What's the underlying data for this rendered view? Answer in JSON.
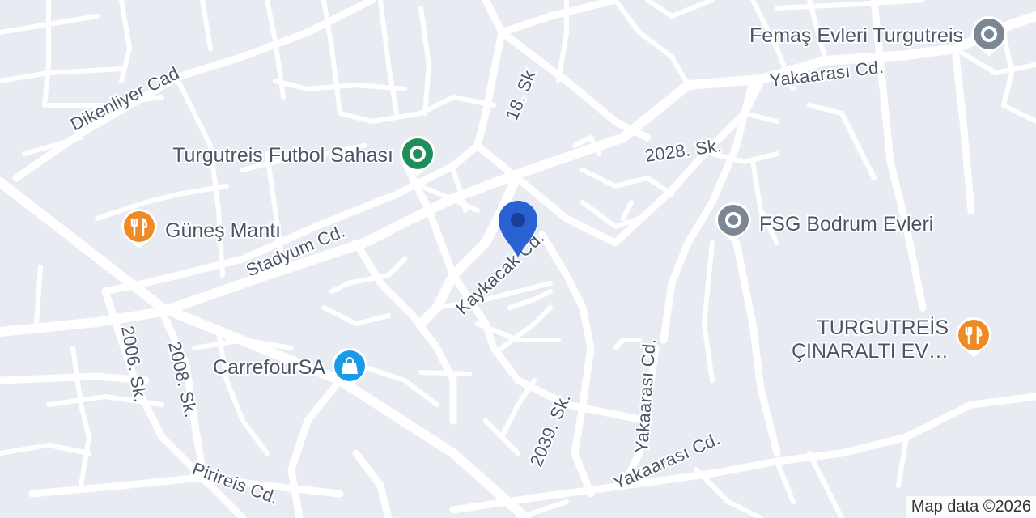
{
  "map": {
    "attribution": "Map data ©2026",
    "roads": [
      {
        "label": "Dikenliyer Cad",
        "name": "road-label-dikenliyer"
      },
      {
        "label": "18. Sk",
        "name": "road-label-18-sk"
      },
      {
        "label": "Yakaarası Cd.",
        "name": "road-label-yakaarasi-top"
      },
      {
        "label": "2028. Sk.",
        "name": "road-label-2028-sk"
      },
      {
        "label": "Stadyum Cd.",
        "name": "road-label-stadyum"
      },
      {
        "label": "Kaykacak Cd.",
        "name": "road-label-kaykacak"
      },
      {
        "label": "2006. Sk.",
        "name": "road-label-2006-sk"
      },
      {
        "label": "2008. Sk.",
        "name": "road-label-2008-sk"
      },
      {
        "label": "2039. Sk.",
        "name": "road-label-2039-sk"
      },
      {
        "label": "Yakaarası Cd.",
        "name": "road-label-yakaarasi-vertical"
      },
      {
        "label": "Yakaarası Cd.",
        "name": "road-label-yakaarasi-bottom"
      },
      {
        "label": "Pirireis Cd.",
        "name": "road-label-pirireis"
      }
    ],
    "places": [
      {
        "label": "Femaş Evleri Turgutreis",
        "kind": "generic",
        "color": "#7b8794"
      },
      {
        "label": "Turgutreis Futbol Sahası",
        "kind": "park",
        "color": "#1e8e5a"
      },
      {
        "label": "Güneş Mantı",
        "kind": "restaurant",
        "color": "#f08a24"
      },
      {
        "label": "FSG Bodrum Evleri",
        "kind": "generic",
        "color": "#7b8794"
      },
      {
        "label": "TURGUTREİS",
        "label2": "ÇINARALTI EV…",
        "kind": "restaurant",
        "color": "#f08a24"
      },
      {
        "label": "CarrefourSA",
        "kind": "shopping",
        "color": "#1a9be8"
      }
    ],
    "selected_pin_color": "#2a62d3"
  }
}
